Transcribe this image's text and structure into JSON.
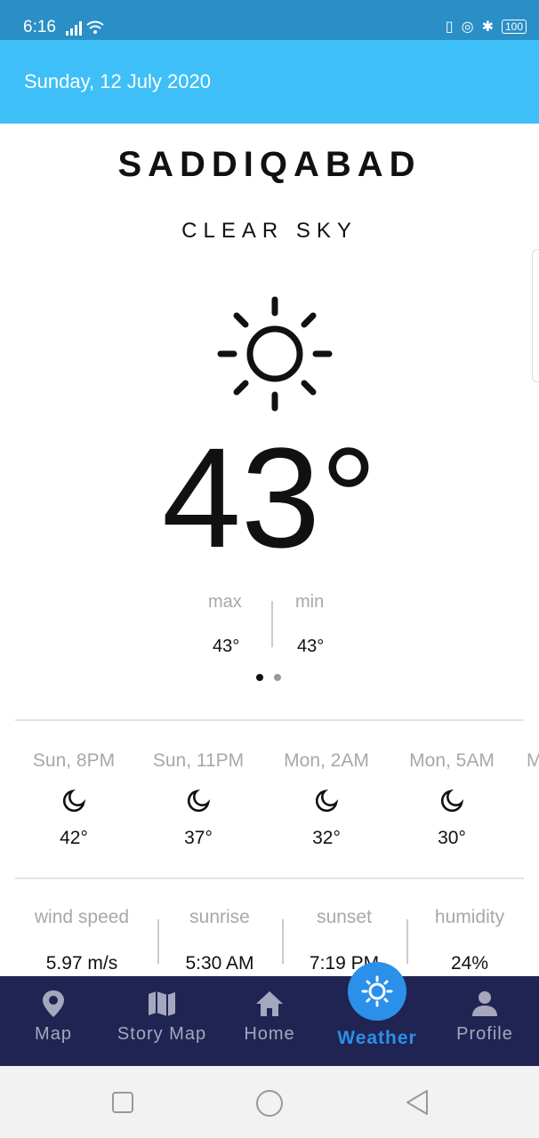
{
  "status": {
    "time": "6:16",
    "battery": "100"
  },
  "header": {
    "date": "Sunday, 12 July 2020",
    "action_icon": "my-location-icon"
  },
  "weather": {
    "city": "SADDIQABAD",
    "condition": "CLEAR SKY",
    "icon": "sun-icon",
    "temperature": "43°",
    "max_label": "max",
    "max_value": "43°",
    "min_label": "min",
    "min_value": "43°"
  },
  "hourly": [
    {
      "time": "Sun, 8PM",
      "icon": "moon-icon",
      "temp": "42°"
    },
    {
      "time": "Sun, 11PM",
      "icon": "moon-icon",
      "temp": "37°"
    },
    {
      "time": "Mon, 2AM",
      "icon": "moon-icon",
      "temp": "32°"
    },
    {
      "time": "Mon, 5AM",
      "icon": "moon-icon",
      "temp": "30°"
    },
    {
      "time": "M"
    }
  ],
  "details": [
    {
      "label": "wind speed",
      "value": "5.97 m/s"
    },
    {
      "label": "sunrise",
      "value": "5:30 AM"
    },
    {
      "label": "sunset",
      "value": "7:19 PM"
    },
    {
      "label": "humidity",
      "value": "24%"
    }
  ],
  "nav": [
    {
      "label": "Map",
      "icon": "map-pin-icon"
    },
    {
      "label": "Story Map",
      "icon": "folded-map-icon"
    },
    {
      "label": "Home",
      "icon": "home-icon"
    },
    {
      "label": "Weather",
      "icon": "sun-icon"
    },
    {
      "label": "Profile",
      "icon": "person-icon"
    }
  ],
  "colors": {
    "appbar": "#3ebff8",
    "statusbar": "#2a8fc6",
    "navbar": "#1f2453",
    "accent": "#2b90e9"
  }
}
